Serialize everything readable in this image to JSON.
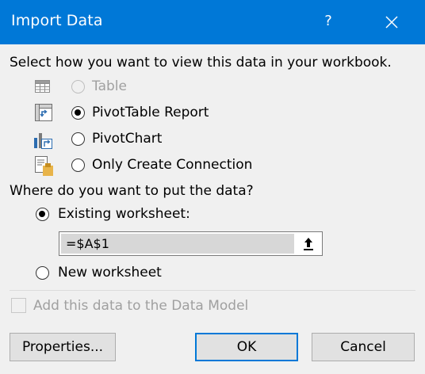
{
  "window": {
    "title": "Import Data",
    "help_label": "?"
  },
  "view_section": {
    "prompt": "Select how you want to view this data in your workbook.",
    "options": [
      {
        "label": "Table",
        "selected": false,
        "enabled": false,
        "icon": "table-icon"
      },
      {
        "label": "PivotTable Report",
        "selected": true,
        "enabled": true,
        "icon": "pivottable-icon"
      },
      {
        "label": "PivotChart",
        "selected": false,
        "enabled": true,
        "icon": "pivotchart-icon"
      },
      {
        "label": "Only Create Connection",
        "selected": false,
        "enabled": true,
        "icon": "connection-icon"
      }
    ]
  },
  "location_section": {
    "prompt": "Where do you want to put the data?",
    "existing_label": "Existing worksheet:",
    "existing_selected": true,
    "cell_reference": "=$A$1",
    "new_label": "New worksheet",
    "new_selected": false
  },
  "data_model": {
    "label": "Add this data to the Data Model",
    "checked": false,
    "enabled": false
  },
  "buttons": {
    "properties": "Properties...",
    "ok": "OK",
    "cancel": "Cancel"
  },
  "colors": {
    "titlebar": "#0078d7",
    "background": "#f0f0f0",
    "default_button_border": "#0078d7"
  }
}
